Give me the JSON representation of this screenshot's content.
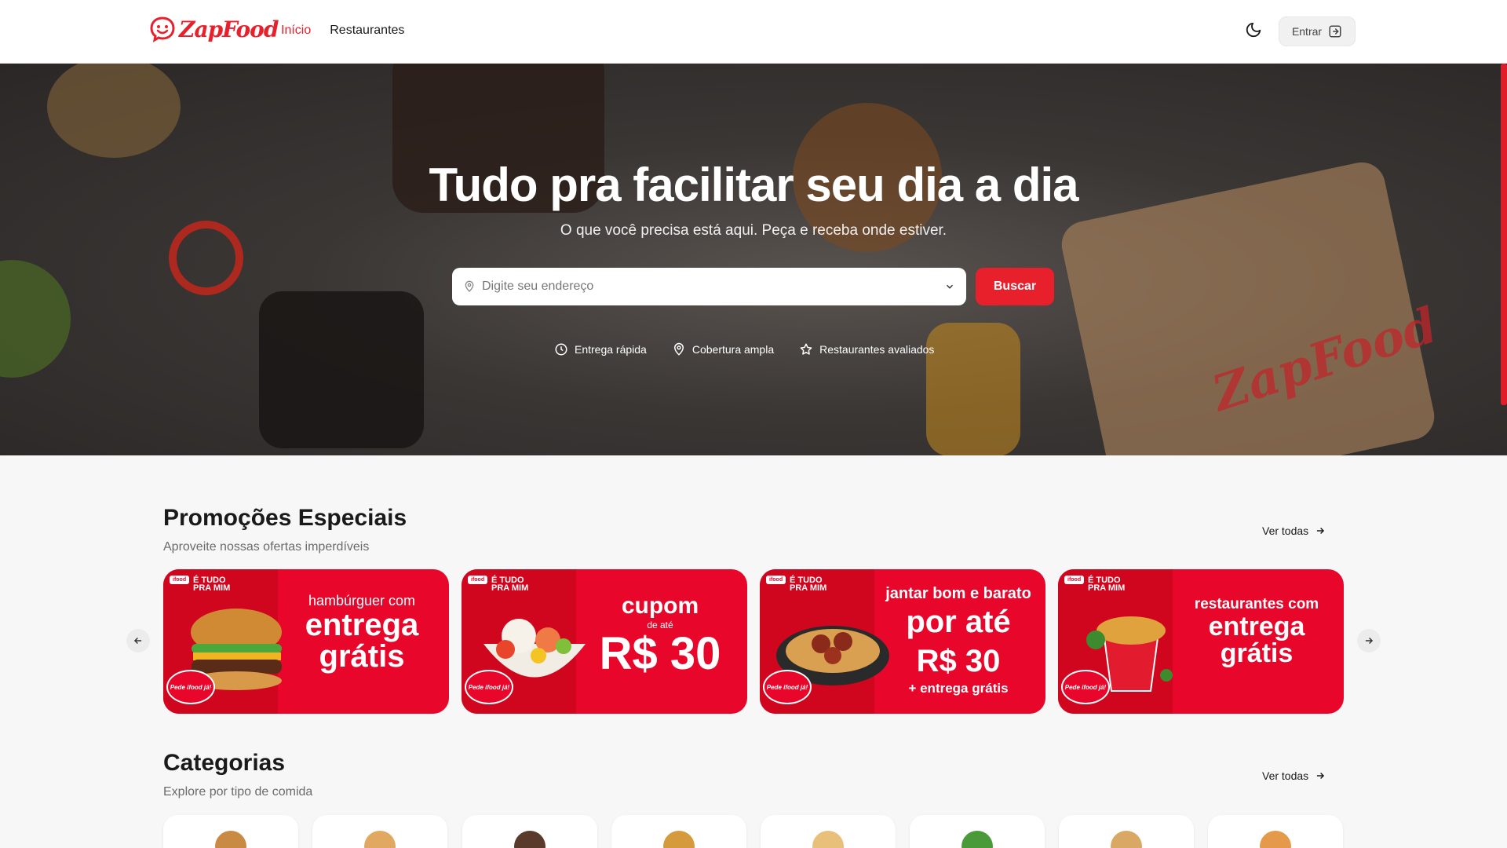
{
  "header": {
    "logo_text": "ZapFood",
    "nav": [
      {
        "label": "Início",
        "active": true
      },
      {
        "label": "Restaurantes",
        "active": false
      }
    ],
    "theme_icon": "moon-icon",
    "login_label": "Entrar",
    "login_icon": "sign-in-icon"
  },
  "hero": {
    "title": "Tudo pra facilitar seu dia a dia",
    "subtitle": "O que você precisa está aqui. Peça e receba onde estiver.",
    "search_placeholder": "Digite seu endereço",
    "search_button": "Buscar",
    "features": [
      {
        "label": "Entrega rápida",
        "icon": "clock-icon"
      },
      {
        "label": "Cobertura ampla",
        "icon": "map-pin-icon"
      },
      {
        "label": "Restaurantes avaliados",
        "icon": "star-icon"
      }
    ],
    "bag_text": "ZapFood"
  },
  "promotions": {
    "title": "Promoções Especiais",
    "subtitle": "Aproveite nossas ofertas imperdíveis",
    "see_all": "Ver todas",
    "cards": [
      {
        "badge": "ifood",
        "tag": "É TUDO PRA MIM",
        "pede": "Pede ifood já!",
        "line1": "hambúrguer com",
        "line2": "entrega",
        "line3": "grátis",
        "food": "burger"
      },
      {
        "badge": "ifood",
        "tag": "É TUDO PRA MIM",
        "pede": "Pede ifood já!",
        "line1": "cupom",
        "line2": "de até",
        "line3": "R$ 30",
        "food": "poke"
      },
      {
        "badge": "ifood",
        "tag": "É TUDO PRA MIM",
        "pede": "Pede ifood já!",
        "line1": "jantar bom e barato",
        "line2": "por até R$ 30",
        "line3": "+ entrega grátis",
        "food": "pasta"
      },
      {
        "badge": "ifood",
        "tag": "É TUDO PRA MIM",
        "pede": "Pede ifood já!",
        "line1": "restaurantes com",
        "line2": "entrega",
        "line3": "grátis",
        "food": "noodles"
      }
    ]
  },
  "categories": {
    "title": "Categorias",
    "subtitle": "Explore por tipo de comida",
    "see_all": "Ver todas",
    "count": 8
  },
  "colors": {
    "brand": "#e8202c",
    "promo": "#e8072b"
  }
}
